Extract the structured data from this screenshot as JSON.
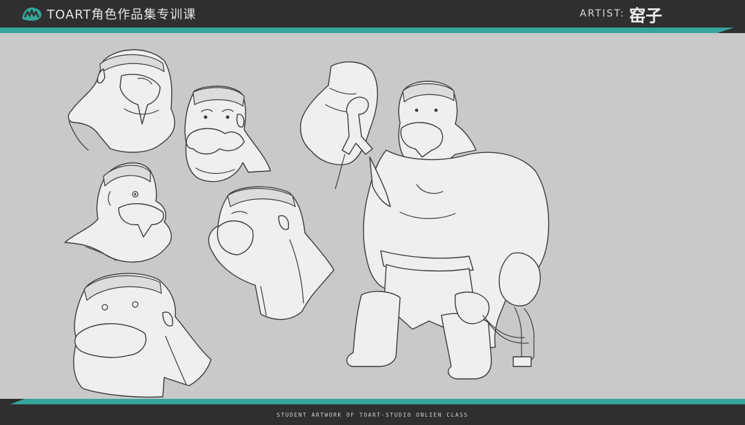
{
  "header": {
    "brand_text": "TOART角色作品集专训课",
    "artist_label": "ARTIST:",
    "artist_name": "窑子",
    "logo_icon": "toart-logo-icon"
  },
  "footer": {
    "caption": "STUDENT ARTWORK OF TOART-STUDIO ONLIEN CLASS"
  },
  "colors": {
    "bar_dark": "#2f2f2f",
    "accent_teal": "#36a59a",
    "canvas_gray": "#c9c9c9"
  }
}
